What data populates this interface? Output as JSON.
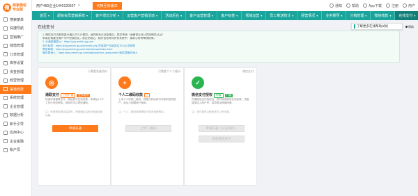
{
  "brand": {
    "logo_text_1": "商家微信",
    "logo_text_2": "专业版"
  },
  "sidebar": {
    "items": [
      {
        "label": "搜索菜单",
        "active": false
      },
      {
        "label": "快捷导航",
        "active": false
      },
      {
        "label": "营销推广",
        "active": false
      },
      {
        "label": "储值管理",
        "active": false
      },
      {
        "label": "订单管理",
        "active": false
      },
      {
        "label": "库存设置",
        "active": false
      },
      {
        "label": "资金管理",
        "active": false
      },
      {
        "label": "经营管理",
        "active": false
      },
      {
        "label": "渠道收款",
        "active": true
      },
      {
        "label": "系统管理",
        "active": false
      },
      {
        "label": "企业管理",
        "active": false
      },
      {
        "label": "数据分析",
        "active": false
      },
      {
        "label": "新手引导",
        "active": false
      },
      {
        "label": "应用中心",
        "active": false
      },
      {
        "label": "企业金融",
        "active": false
      },
      {
        "label": "帐户员",
        "active": false
      }
    ]
  },
  "topbar": {
    "store": "用户460企业1440120507",
    "caret": "▾",
    "action_button": "切换至旧版本",
    "right_items": [
      "通知",
      "帮助",
      "App下载",
      "注册",
      "用户"
    ]
  },
  "nav": {
    "items": [
      {
        "label": "首页",
        "active": false
      },
      {
        "label": "超级会员营销系统",
        "active": false
      },
      {
        "label": "客户增长分析",
        "active": false
      },
      {
        "label": "运营客户营销活动",
        "active": false
      },
      {
        "label": "活动后台",
        "active": false
      },
      {
        "label": "客户运营管理",
        "active": false
      },
      {
        "label": "客户标签",
        "active": false
      },
      {
        "label": "领域运营",
        "active": false
      },
      {
        "label": "员工推送统计",
        "active": false
      },
      {
        "label": "经营情况",
        "active": false
      },
      {
        "label": "业务督导",
        "active": false
      },
      {
        "label": "分销管理",
        "active": false
      },
      {
        "label": "微信收款",
        "active": false
      },
      {
        "label": "在线支付",
        "active": true
      }
    ],
    "tail": "›"
  },
  "page": {
    "title": "在线支付",
    "notice": "了解更多在线帮助试试",
    "help": "帮助"
  },
  "info": {
    "lines": [
      "1. 微信支付功能需要开通后才可以使用，请先联系企业管理员，提交申请（请确保企业已完成微信认证）",
      "   申请后需要在商户号中完成验证，验证完成后，相关信息将同步到系统中，请耐心等待审核结果。",
      "2. 开通渠道提示：https://pay.weixin.qq.com",
      "   支付配置：https://pay.weixin.qq.com/index.php 完成商户号配置后方可正常收款",
      "   常用帮助：https://pay.weixin.qq.com/wiki/doc/api/index.html",
      "   服务商接入：https://pay.weixin.qq.com/static/partner_apply.shtml 服务商模式接入"
    ]
  },
  "cards": [
    {
      "tag": "只需要准备资料",
      "title": "通联支付",
      "badge": "已经开通",
      "badge2": "更多说明",
      "icon_symbol": "◎",
      "color": "#ff7a1a",
      "desc": "快速申请通联支付，随后即可在线收款，申请后1-3个工作日完成审核，请及时关注短信通知。",
      "note": "注：申请资料请如实填写，审核通过后即可使用收款功能。",
      "button": "申请开通",
      "enabled": true
    },
    {
      "tag": "只需要个人二维码",
      "title": "个人二维码收款",
      "badge": "?",
      "badge2": "",
      "icon_symbol": "+",
      "color": "#ff7a1a",
      "desc": "上传个人收款二维码，顾客扫码后即可付款到您的账户，适合小规模商户使用。",
      "note": "注：个人二维码收款需自行核对到账情况。",
      "button": "上传二维码",
      "enabled": false
    },
    {
      "tag": "微信支付",
      "title": "微信支付授权",
      "badge": "申请",
      "badge2": "开通",
      "icon_symbol": "✓",
      "color": "#2ab551",
      "desc": "开通微信支付授权后，即可使用微信在线收款，资金直接进入商户号，结算更加便捷快速。",
      "note": "注：支付费率以微信官方公布为准。",
      "button": "申请开通（认证资料）",
      "button2": "授权微信支付",
      "enabled": false
    }
  ]
}
